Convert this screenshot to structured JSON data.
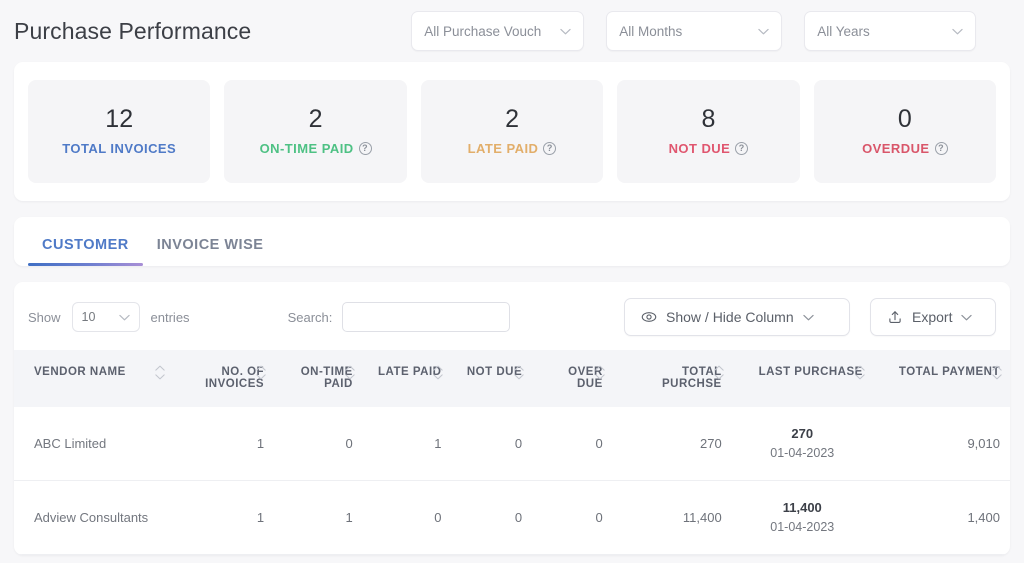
{
  "header": {
    "title": "Purchase Performance",
    "filters": [
      {
        "name": "voucher-type",
        "value": "All Purchase Vouch"
      },
      {
        "name": "month",
        "value": "All Months"
      },
      {
        "name": "year",
        "value": "All Years"
      }
    ]
  },
  "kpis": [
    {
      "value": "12",
      "label": "TOTAL INVOICES",
      "color": "#4f7ac7",
      "info": false
    },
    {
      "value": "2",
      "label": "ON-TIME PAID",
      "color": "#4ec184",
      "info": true
    },
    {
      "value": "2",
      "label": "LATE PAID",
      "color": "#e2ae6a",
      "info": true
    },
    {
      "value": "8",
      "label": "NOT DUE",
      "color": "#e0566f",
      "info": true
    },
    {
      "value": "0",
      "label": "OVERDUE",
      "color": "#d9566a",
      "info": true
    }
  ],
  "tabs": [
    {
      "label": "CUSTOMER",
      "active": true
    },
    {
      "label": "INVOICE WISE",
      "active": false
    }
  ],
  "toolbar": {
    "show_label": "Show",
    "entries_value": "10",
    "entries_label": "entries",
    "search_label": "Search:",
    "search_value": "",
    "search_placeholder": "",
    "show_hide_column_label": "Show / Hide Column",
    "export_label": "Export"
  },
  "table": {
    "columns": [
      "VENDOR NAME",
      "NO. OF INVOICES",
      "ON-TIME PAID",
      "LATE PAID",
      "NOT DUE",
      "OVER DUE",
      "TOTAL PURCHSE",
      "LAST PURCHASE",
      "TOTAL PAYMENT"
    ],
    "rows": [
      {
        "vendor": "ABC Limited",
        "no_of_invoices": "1",
        "on_time_paid": "0",
        "late_paid": "1",
        "not_due": "0",
        "over_due": "0",
        "total_purchase": "270",
        "last_purchase_amount": "270",
        "last_purchase_date": "01-04-2023",
        "total_payment": "9,010"
      },
      {
        "vendor": "Adview Consultants",
        "no_of_invoices": "1",
        "on_time_paid": "1",
        "late_paid": "0",
        "not_due": "0",
        "over_due": "0",
        "total_purchase": "11,400",
        "last_purchase_amount": "11,400",
        "last_purchase_date": "01-04-2023",
        "total_payment": "1,400"
      }
    ]
  }
}
